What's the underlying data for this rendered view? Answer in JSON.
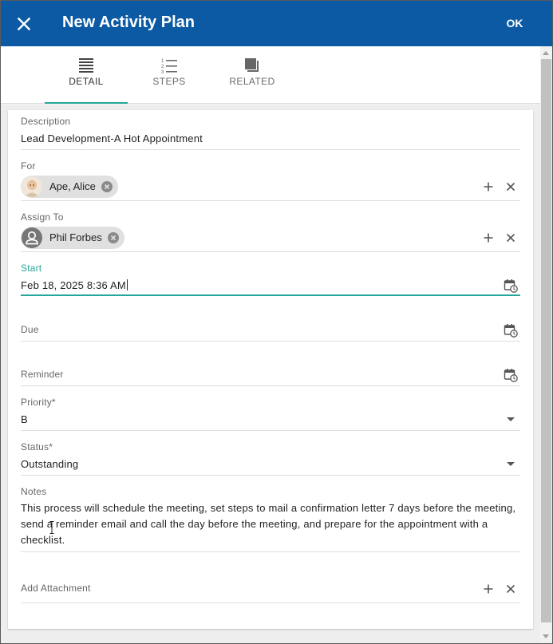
{
  "header": {
    "title": "New Activity Plan",
    "ok_label": "OK",
    "close_icon": "close-icon",
    "color": "#0b5aa3"
  },
  "tabs": [
    {
      "label": "DETAIL",
      "icon": "detail-lines-icon",
      "active": true
    },
    {
      "label": "STEPS",
      "icon": "numbered-list-icon",
      "active": false
    },
    {
      "label": "RELATED",
      "icon": "related-stack-icon",
      "active": false
    }
  ],
  "accent_color": "#26a69a",
  "form": {
    "description": {
      "label": "Description",
      "value": "Lead Development-A Hot Appointment"
    },
    "for": {
      "label": "For",
      "chip": "Ape, Alice",
      "chip_avatar": "contact-photo-avatar"
    },
    "assign_to": {
      "label": "Assign To",
      "chip": "Phil Forbes",
      "chip_avatar": "person-icon"
    },
    "start": {
      "label": "Start",
      "value": "Feb 18, 2025 8:36 AM",
      "icon": "calendar-clock-icon"
    },
    "due": {
      "label": "Due",
      "value": "",
      "icon": "calendar-clock-icon"
    },
    "reminder": {
      "label": "Reminder",
      "value": "",
      "icon": "calendar-clock-icon"
    },
    "priority": {
      "label": "Priority*",
      "value": "B"
    },
    "status": {
      "label": "Status*",
      "value": "Outstanding"
    },
    "notes": {
      "label": "Notes",
      "value": "This process will schedule the meeting, set steps to mail a confirmation letter 7 days before the meeting, send a reminder email and call the day before the meeting, and prepare for the appointment with a checklist."
    },
    "attachment": {
      "label": "Add Attachment"
    }
  }
}
